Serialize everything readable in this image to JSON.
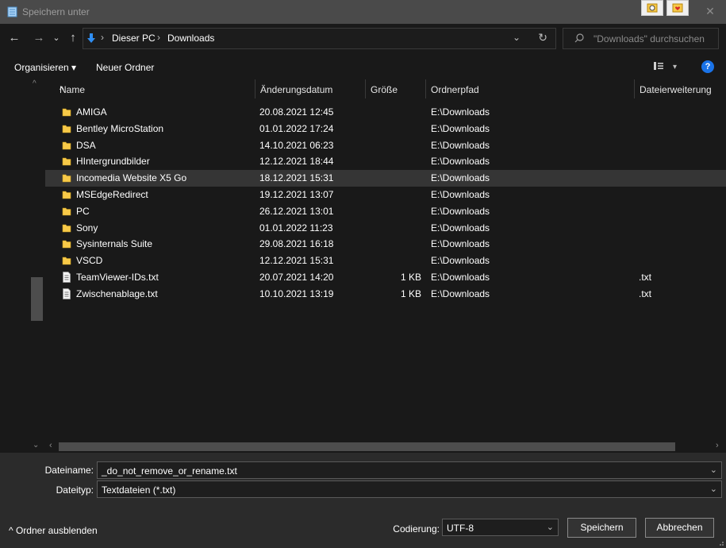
{
  "window": {
    "title": "Speichern unter",
    "close_glyph": "✕"
  },
  "nav": {
    "back": "←",
    "forward": "→",
    "history": "⌄",
    "up": "↑",
    "breadcrumbs": [
      "Dieser PC",
      "Downloads"
    ],
    "separator": "›",
    "address_dropdown": "⌄",
    "refresh": "↻",
    "search_placeholder": "\"Downloads\" durchsuchen"
  },
  "toolbar": {
    "organize": "Organisieren ▾",
    "new_folder": "Neuer Ordner",
    "view_dropdown": "▾",
    "help": "?"
  },
  "columns": {
    "name": "Name",
    "date": "Änderungsdatum",
    "size": "Größe",
    "path": "Ordnerpfad",
    "ext": "Dateierweiterung",
    "sort_indicator": "^"
  },
  "files": [
    {
      "name": "AMIGA",
      "date": "20.08.2021 12:45",
      "size": "",
      "path": "E:\\Downloads",
      "ext": "",
      "type": "folder"
    },
    {
      "name": "Bentley MicroStation",
      "date": "01.01.2022 17:24",
      "size": "",
      "path": "E:\\Downloads",
      "ext": "",
      "type": "folder"
    },
    {
      "name": "DSA",
      "date": "14.10.2021 06:23",
      "size": "",
      "path": "E:\\Downloads",
      "ext": "",
      "type": "folder"
    },
    {
      "name": "HIntergrundbilder",
      "date": "12.12.2021 18:44",
      "size": "",
      "path": "E:\\Downloads",
      "ext": "",
      "type": "folder"
    },
    {
      "name": "Incomedia Website X5 Go",
      "date": "18.12.2021 15:31",
      "size": "",
      "path": "E:\\Downloads",
      "ext": "",
      "type": "folder",
      "selected": true
    },
    {
      "name": "MSEdgeRedirect",
      "date": "19.12.2021 13:07",
      "size": "",
      "path": "E:\\Downloads",
      "ext": "",
      "type": "folder"
    },
    {
      "name": "PC",
      "date": "26.12.2021 13:01",
      "size": "",
      "path": "E:\\Downloads",
      "ext": "",
      "type": "folder"
    },
    {
      "name": "Sony",
      "date": "01.01.2022 11:23",
      "size": "",
      "path": "E:\\Downloads",
      "ext": "",
      "type": "folder"
    },
    {
      "name": "Sysinternals Suite",
      "date": "29.08.2021 16:18",
      "size": "",
      "path": "E:\\Downloads",
      "ext": "",
      "type": "folder"
    },
    {
      "name": "VSCD",
      "date": "12.12.2021 15:31",
      "size": "",
      "path": "E:\\Downloads",
      "ext": "",
      "type": "folder"
    },
    {
      "name": "TeamViewer-IDs.txt",
      "date": "20.07.2021 14:20",
      "size": "1 KB",
      "path": "E:\\Downloads",
      "ext": ".txt",
      "type": "file"
    },
    {
      "name": "Zwischenablage.txt",
      "date": "10.10.2021 13:19",
      "size": "1 KB",
      "path": "E:\\Downloads",
      "ext": ".txt",
      "type": "file"
    }
  ],
  "scroll": {
    "up": "^",
    "down": "⌄",
    "left": "‹",
    "right": "›"
  },
  "form": {
    "filename_label": "Dateiname:",
    "filename_value": "_do_not_remove_or_rename.txt",
    "filetype_label": "Dateityp:",
    "filetype_value": "Textdateien (*.txt)",
    "dropdown": "⌄",
    "encoding_label": "Codierung:",
    "encoding_value": "UTF-8",
    "hide_folders": "^ Ordner ausblenden",
    "save": "Speichern",
    "cancel": "Abbrechen"
  },
  "colors": {
    "folder": "#f7c948",
    "accent": "#1a73e8",
    "selection": "#353535"
  }
}
